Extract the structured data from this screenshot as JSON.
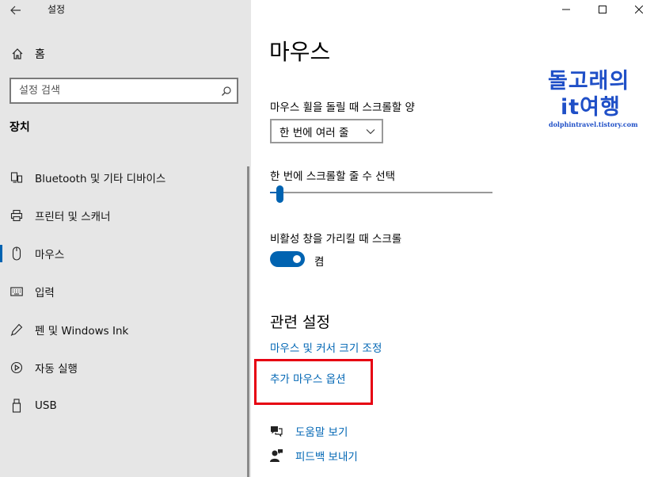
{
  "window": {
    "title": "설정",
    "back_icon": "arrow-left-icon",
    "minimize_label": "—",
    "maximize_label": "☐",
    "close_label": "✕"
  },
  "sidebar": {
    "home_label": "홈",
    "search_placeholder": "설정 검색",
    "section_heading": "장치",
    "items": [
      {
        "label": "Bluetooth 및 기타 디바이스",
        "icon": "bluetooth-devices-icon",
        "selected": false
      },
      {
        "label": "프린터 및 스캐너",
        "icon": "printer-icon",
        "selected": false
      },
      {
        "label": "마우스",
        "icon": "mouse-icon",
        "selected": true
      },
      {
        "label": "입력",
        "icon": "keyboard-icon",
        "selected": false
      },
      {
        "label": "펜 및 Windows Ink",
        "icon": "pen-icon",
        "selected": false
      },
      {
        "label": "자동 실행",
        "icon": "autoplay-icon",
        "selected": false
      },
      {
        "label": "USB",
        "icon": "usb-icon",
        "selected": false
      }
    ]
  },
  "main": {
    "title": "마우스",
    "wheel_label": "마우스 휠을 돌릴 때 스크롤할 양",
    "wheel_value": "한 번에 여러 줄",
    "lines_label": "한 번에 스크롤할 줄 수 선택",
    "lines_slider_fraction": 0.03,
    "inactive_label": "비활성 창을 가리킬 때 스크롤",
    "inactive_state": "켬",
    "inactive_on": true,
    "related_title": "관련 설정",
    "link_cursor": "마우스 및 커서 크기 조정",
    "link_extra": "추가 마우스 옵션",
    "help_label": "도움말 보기",
    "feedback_label": "피드백 보내기"
  },
  "watermark": {
    "line1": "돌고래의",
    "line2": "it여행",
    "url": "dolphintravel.tistory.com"
  },
  "colors": {
    "accent": "#0063b1",
    "link": "#0066b4",
    "sidebar_bg": "#e6e6e6",
    "highlight": "#e60012",
    "watermark": "#1f4fc7"
  }
}
